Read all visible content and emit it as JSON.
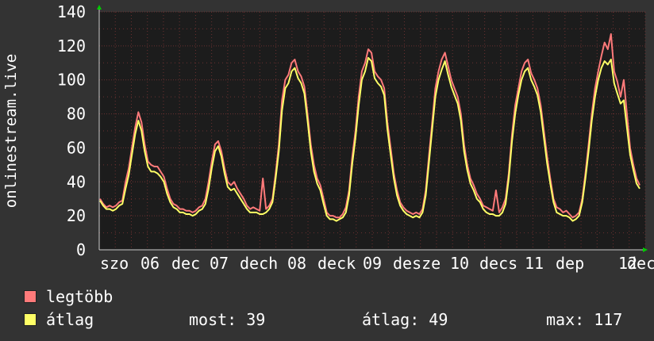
{
  "chart_data": {
    "type": "line",
    "ylabel": "onlinestream.live",
    "ylim": [
      0,
      140
    ],
    "yticks": [
      0,
      20,
      40,
      60,
      80,
      100,
      120,
      140
    ],
    "grid": true,
    "x_labels": [
      "szo 06 dec",
      "v 07 dec",
      "h 08 dec",
      "k 09 dec",
      "sze 10 dec",
      "cs 11 dec",
      "p 12 dec"
    ],
    "x_label_tokens": [
      "szo",
      "06",
      "dec",
      "07",
      "dech",
      "08",
      "deck",
      "09",
      "desze",
      "10",
      "decs",
      "11",
      "dep",
      "12",
      "dec"
    ],
    "series": [
      {
        "name": "legtöbb",
        "color": "#ff7a7a",
        "values": [
          30,
          27,
          25,
          26,
          25,
          26,
          28,
          29,
          40,
          48,
          60,
          72,
          81,
          75,
          62,
          52,
          50,
          49,
          49,
          46,
          43,
          36,
          30,
          27,
          26,
          24,
          24,
          23,
          23,
          22,
          23,
          25,
          26,
          30,
          40,
          52,
          62,
          64,
          58,
          48,
          40,
          38,
          40,
          36,
          33,
          30,
          26,
          24,
          25,
          24,
          23,
          42,
          24,
          26,
          30,
          45,
          62,
          88,
          100,
          103,
          110,
          112,
          105,
          102,
          96,
          80,
          62,
          50,
          42,
          38,
          30,
          22,
          20,
          20,
          19,
          19,
          21,
          25,
          35,
          55,
          70,
          90,
          105,
          110,
          118,
          116,
          105,
          102,
          100,
          95,
          75,
          60,
          45,
          35,
          28,
          25,
          23,
          22,
          21,
          22,
          21,
          24,
          35,
          55,
          75,
          95,
          105,
          112,
          116,
          108,
          100,
          95,
          90,
          80,
          62,
          50,
          42,
          38,
          33,
          30,
          26,
          25,
          24,
          23,
          35,
          22,
          25,
          30,
          45,
          68,
          85,
          95,
          105,
          110,
          112,
          104,
          100,
          95,
          85,
          70,
          55,
          42,
          30,
          25,
          24,
          22,
          23,
          21,
          19,
          20,
          22,
          30,
          45,
          62,
          80,
          95,
          105,
          114,
          122,
          118,
          127,
          105,
          99,
          90,
          100,
          80,
          60,
          50,
          42,
          38
        ]
      },
      {
        "name": "átlag",
        "color": "#ffff66",
        "values": [
          29,
          26,
          24,
          24,
          23,
          24,
          26,
          27,
          36,
          44,
          56,
          68,
          76,
          70,
          58,
          49,
          46,
          46,
          45,
          43,
          40,
          33,
          28,
          25,
          24,
          22,
          22,
          21,
          21,
          20,
          21,
          23,
          24,
          27,
          36,
          48,
          58,
          61,
          55,
          45,
          37,
          35,
          36,
          33,
          30,
          27,
          24,
          22,
          22,
          22,
          21,
          21,
          22,
          24,
          28,
          42,
          58,
          82,
          95,
          98,
          105,
          107,
          101,
          98,
          92,
          76,
          58,
          46,
          39,
          35,
          27,
          20,
          18,
          18,
          17,
          18,
          19,
          22,
          32,
          51,
          66,
          85,
          100,
          105,
          113,
          111,
          101,
          98,
          96,
          91,
          71,
          56,
          42,
          32,
          26,
          23,
          21,
          20,
          19,
          20,
          19,
          22,
          32,
          51,
          71,
          90,
          100,
          106,
          111,
          103,
          96,
          91,
          86,
          76,
          58,
          47,
          39,
          35,
          30,
          28,
          24,
          22,
          21,
          21,
          20,
          20,
          22,
          27,
          42,
          64,
          80,
          91,
          100,
          105,
          107,
          100,
          96,
          91,
          81,
          66,
          51,
          39,
          28,
          22,
          21,
          20,
          20,
          19,
          17,
          18,
          20,
          28,
          42,
          58,
          76,
          90,
          100,
          107,
          111,
          109,
          112,
          98,
          92,
          86,
          88,
          72,
          56,
          47,
          39,
          36
        ]
      }
    ]
  },
  "legend": [
    {
      "name": "legtöbb",
      "color": "#ff7a7a"
    },
    {
      "name": "átlag",
      "color": "#ffff66"
    }
  ],
  "stats": {
    "current": "most: 39",
    "average": "átlag: 49",
    "max": "max: 117"
  }
}
